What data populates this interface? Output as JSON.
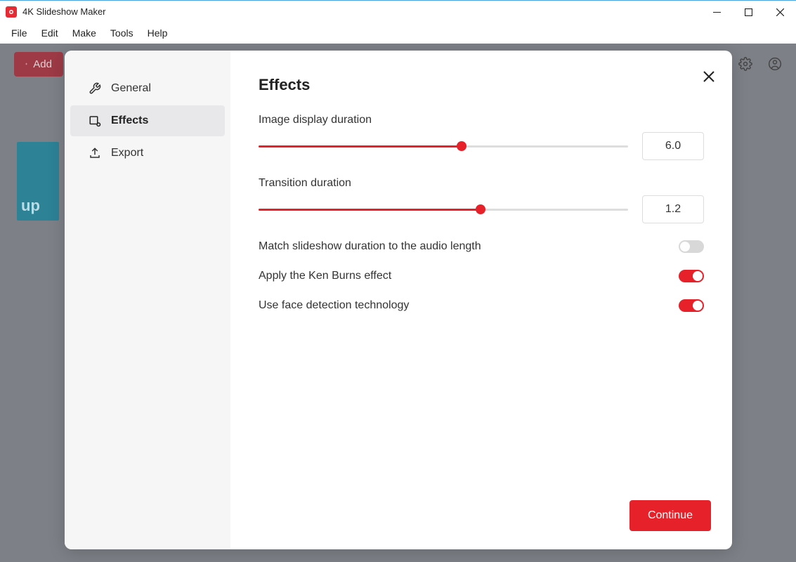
{
  "app": {
    "title": "4K Slideshow Maker"
  },
  "menu": {
    "file": "File",
    "edit": "Edit",
    "make": "Make",
    "tools": "Tools",
    "help": "Help"
  },
  "toolbar": {
    "add_label": "Add"
  },
  "thumb": {
    "text": "up"
  },
  "sidebar": {
    "items": [
      {
        "label": "General"
      },
      {
        "label": "Effects"
      },
      {
        "label": "Export"
      }
    ]
  },
  "panel": {
    "title": "Effects",
    "image_duration_label": "Image display duration",
    "image_duration_value": "6.0",
    "image_duration_percent": 55,
    "transition_duration_label": "Transition duration",
    "transition_duration_value": "1.2",
    "transition_duration_percent": 60,
    "match_audio_label": "Match slideshow duration to the audio length",
    "match_audio_on": false,
    "ken_burns_label": "Apply the Ken Burns effect",
    "ken_burns_on": true,
    "face_detection_label": "Use face detection technology",
    "face_detection_on": true,
    "continue_label": "Continue"
  }
}
